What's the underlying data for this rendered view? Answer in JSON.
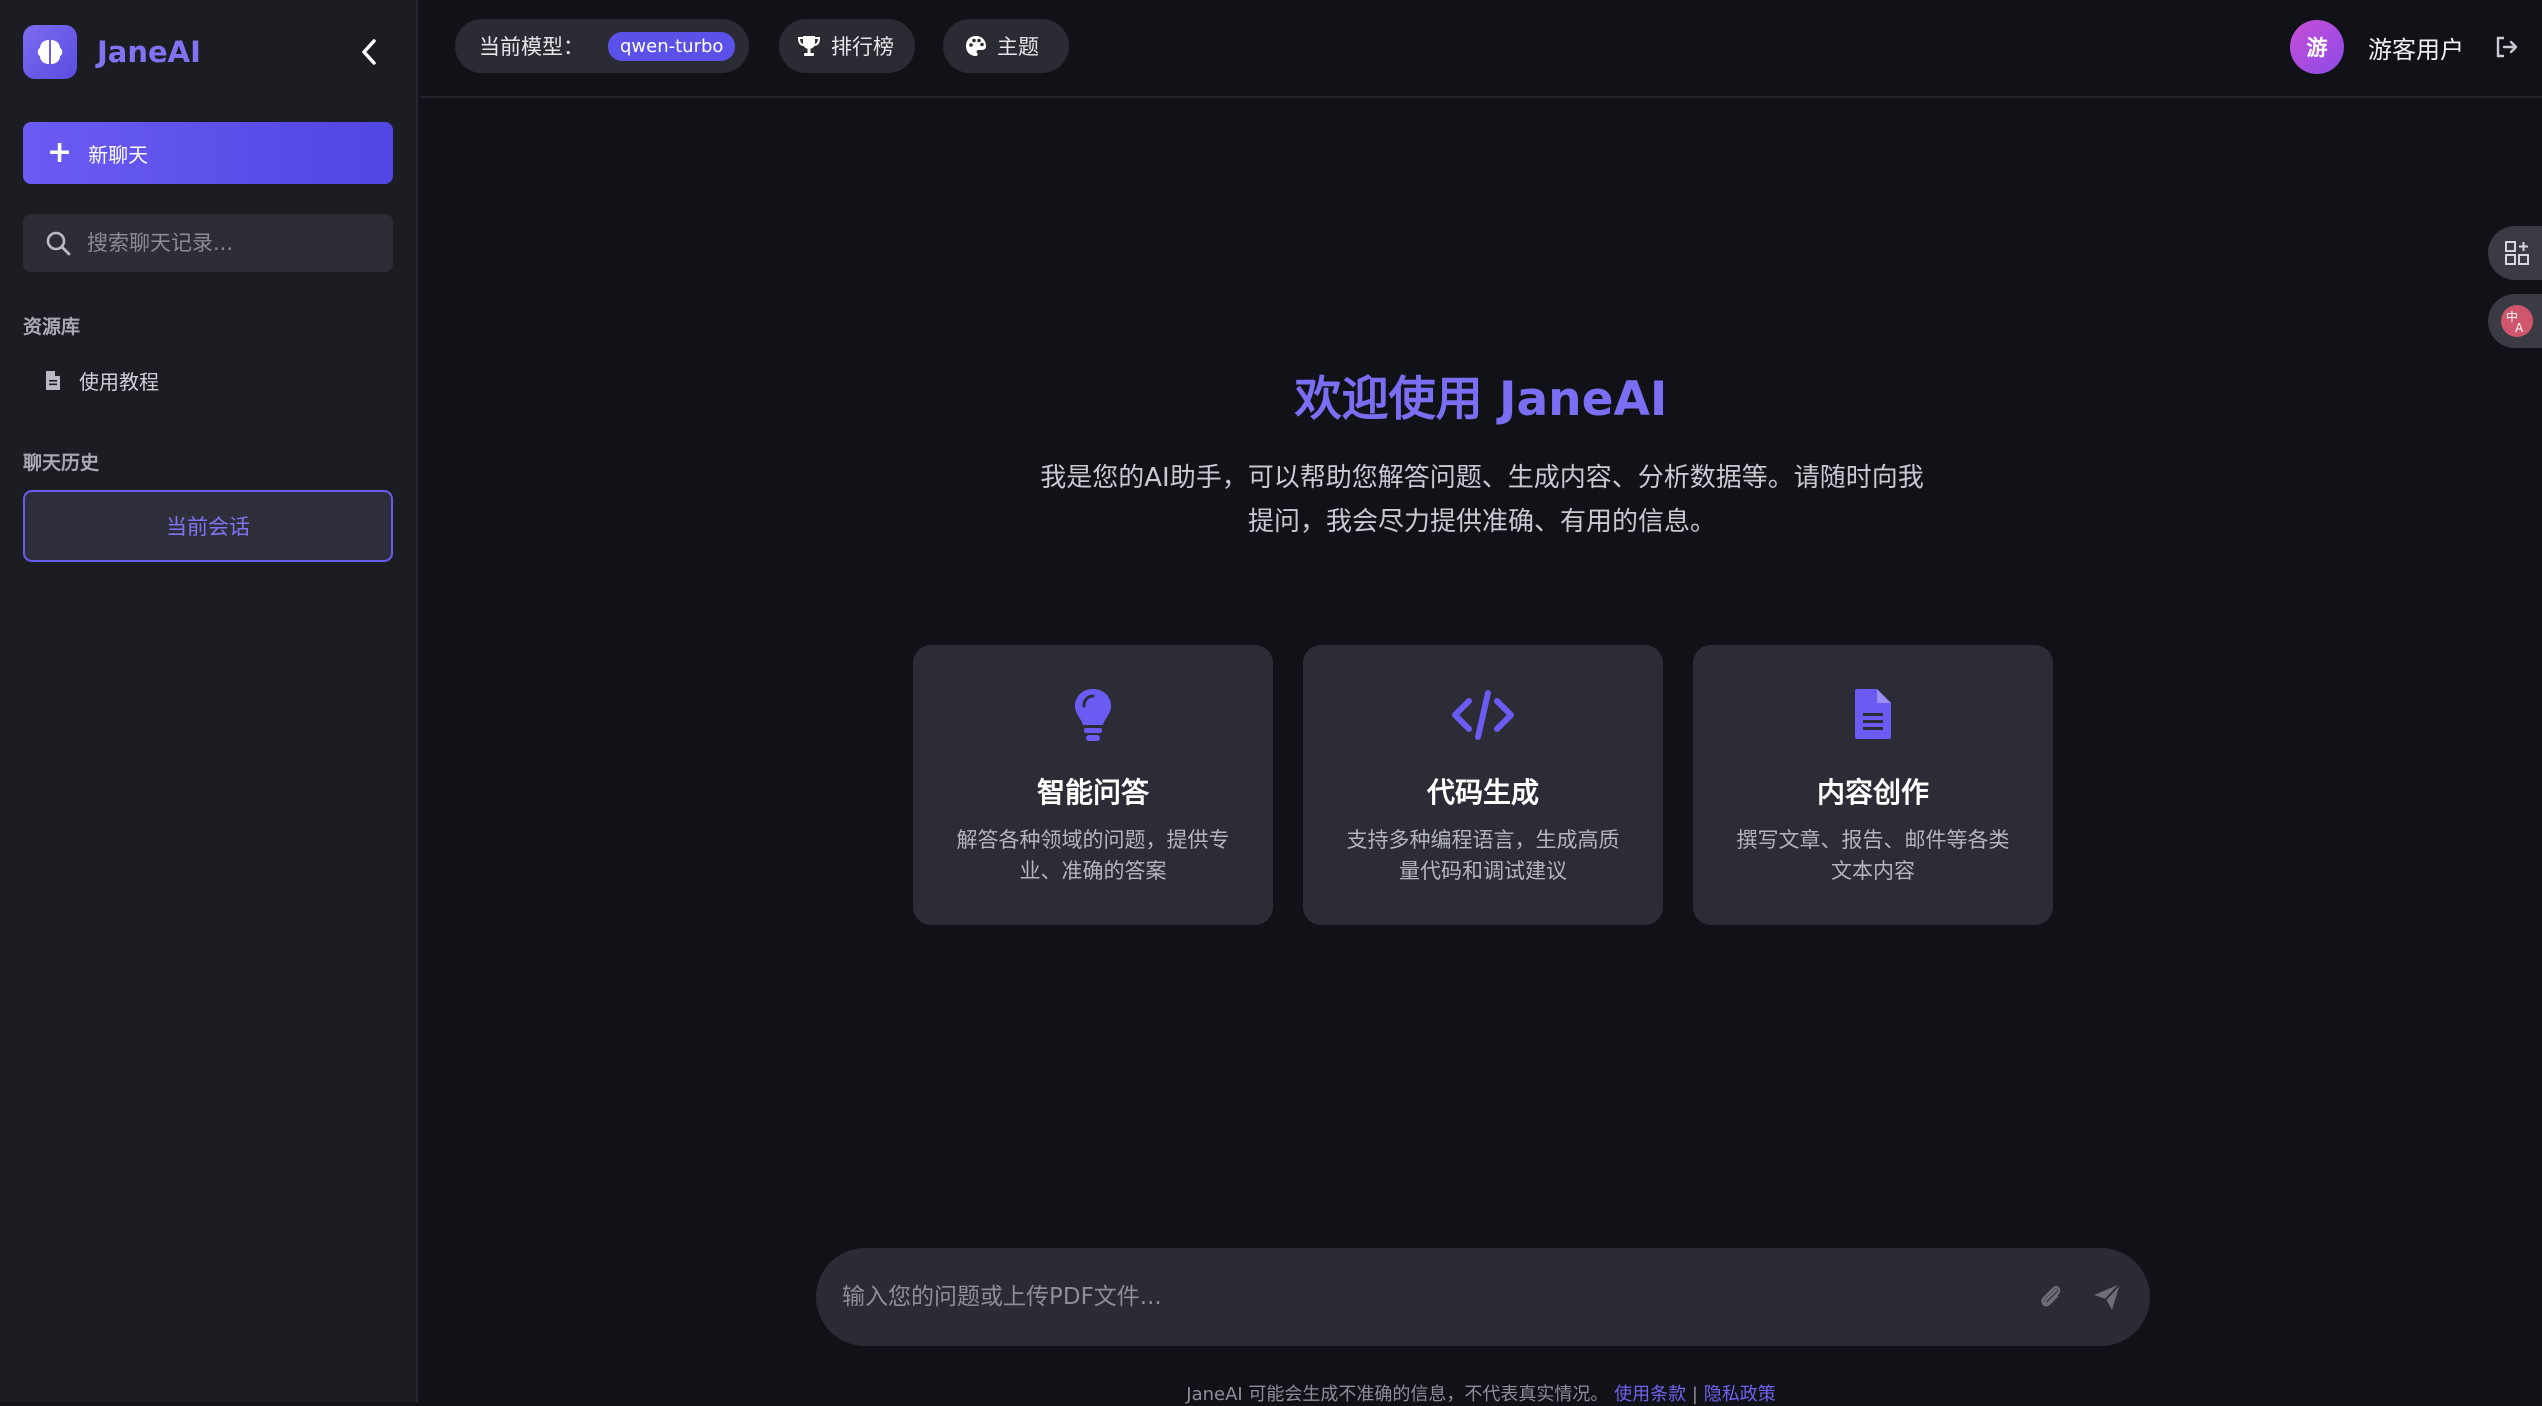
{
  "brand": {
    "name": "JaneAI"
  },
  "sidebar": {
    "new_chat_label": "新聊天",
    "search_placeholder": "搜索聊天记录...",
    "resources_title": "资源库",
    "resources": [
      {
        "label": "使用教程",
        "icon": "file-icon"
      }
    ],
    "history_title": "聊天历史",
    "current_session_label": "当前会话"
  },
  "topbar": {
    "model_label": "当前模型：",
    "model_value": "qwen-turbo",
    "leaderboard_label": "排行榜",
    "theme_label": "主题",
    "user_avatar_text": "游",
    "user_name": "游客用户"
  },
  "welcome": {
    "title": "欢迎使用 JaneAI",
    "description": "我是您的AI助手，可以帮助您解答问题、生成内容、分析数据等。请随时向我提问，我会尽力提供准确、有用的信息。"
  },
  "features": [
    {
      "icon": "lightbulb-icon",
      "title": "智能问答",
      "desc": "解答各种领域的问题，提供专业、准确的答案"
    },
    {
      "icon": "code-icon",
      "title": "代码生成",
      "desc": "支持多种编程语言，生成高质量代码和调试建议"
    },
    {
      "icon": "document-icon",
      "title": "内容创作",
      "desc": "撰写文章、报告、邮件等各类文本内容"
    }
  ],
  "input": {
    "placeholder": "输入您的问题或上传PDF文件..."
  },
  "footer": {
    "text": "JaneAI 可能会生成不准确的信息，不代表真实情况。",
    "terms_label": "使用条款",
    "separator": "|",
    "privacy_label": "隐私政策"
  },
  "colors": {
    "accent": "#6a5cf2",
    "background": "#111218",
    "sidebar": "#1c1d23",
    "card": "#2b2c35"
  }
}
